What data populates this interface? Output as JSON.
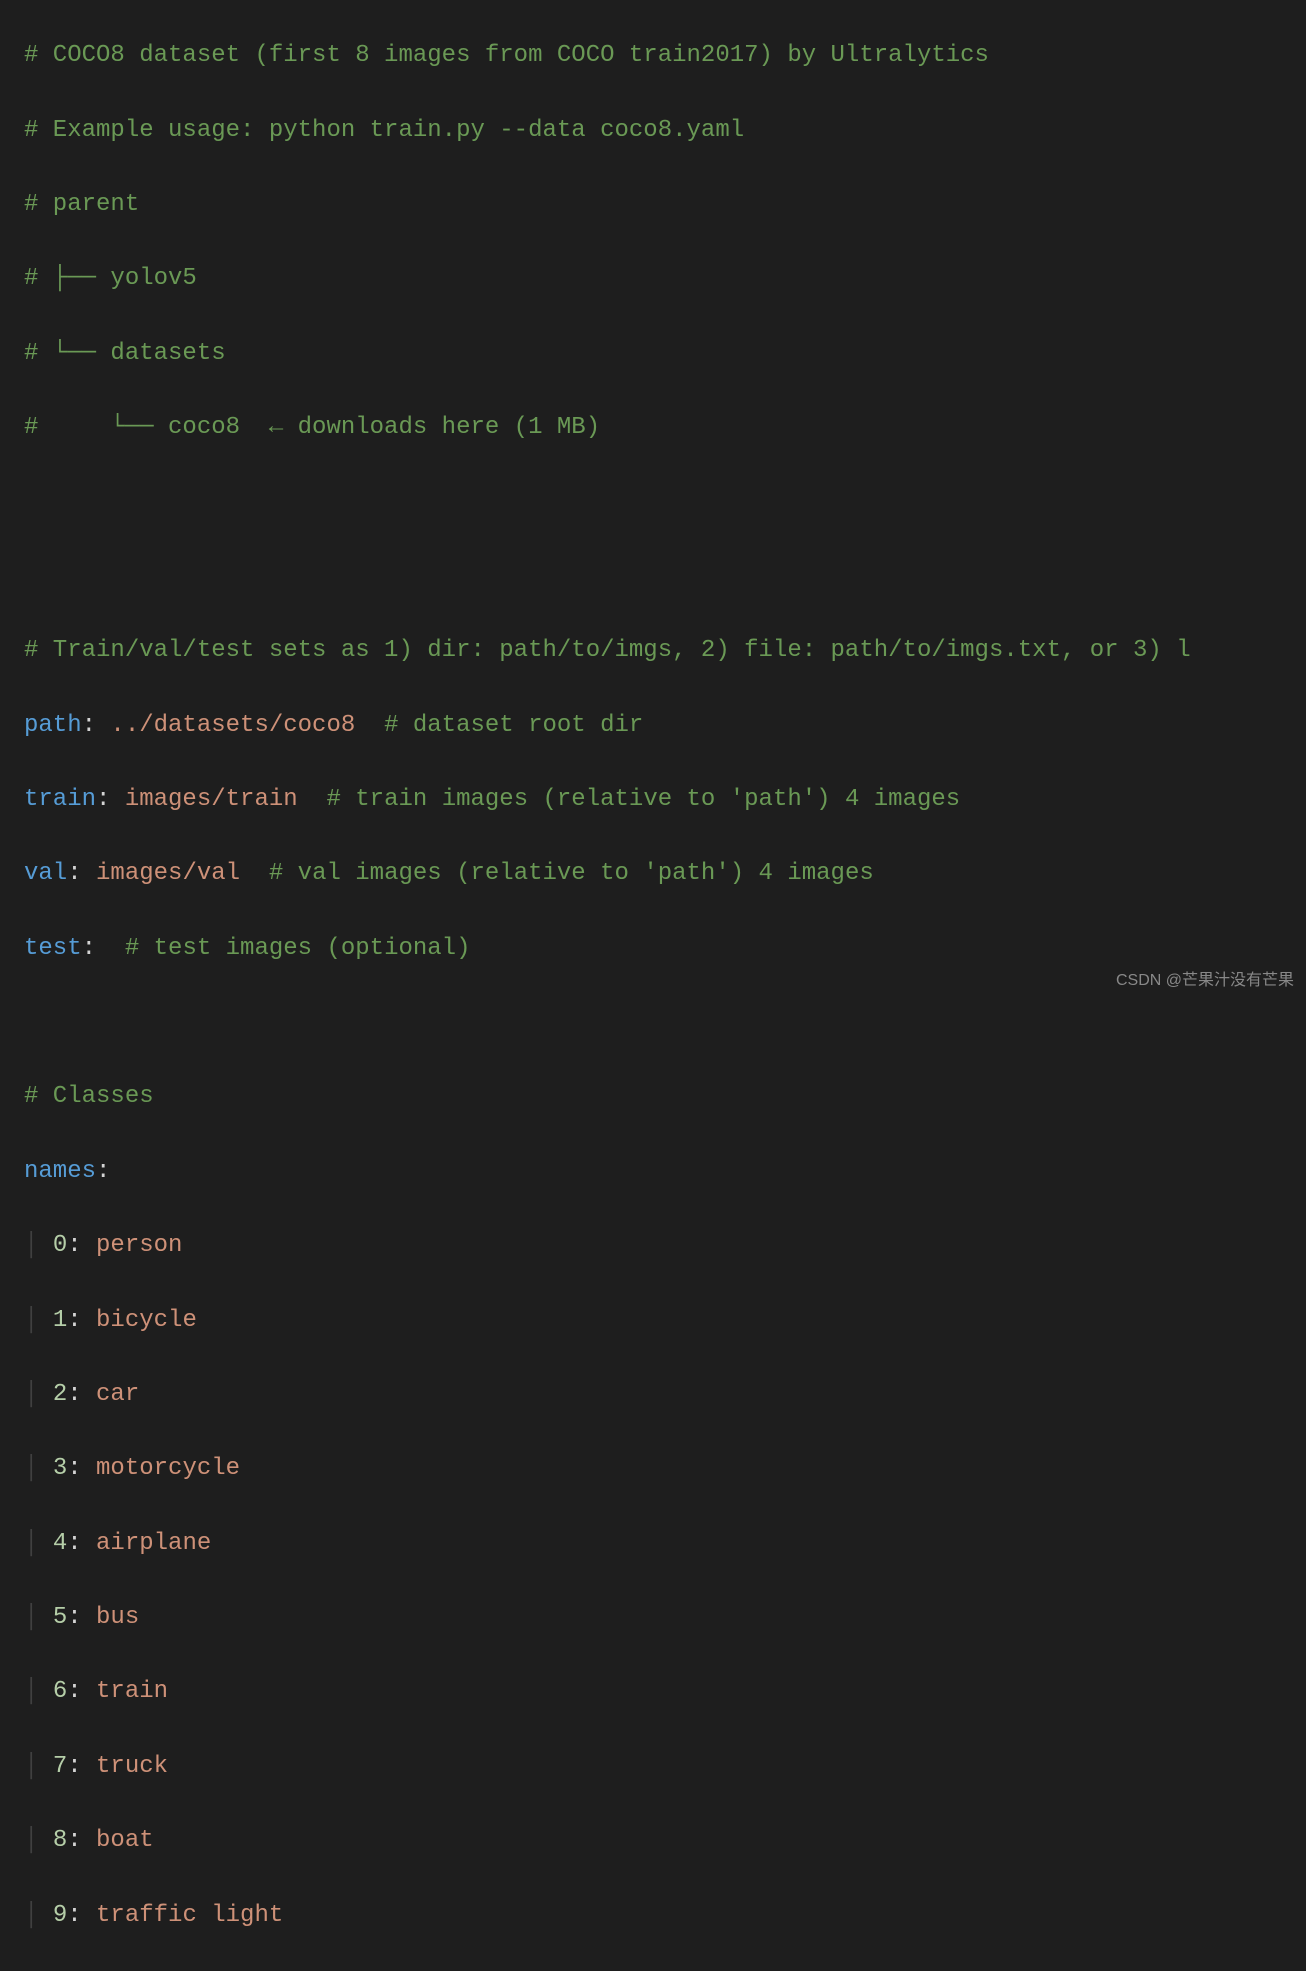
{
  "lines": {
    "l1": "# COCO8 dataset (first 8 images from COCO train2017) by Ultralytics",
    "l2": "# Example usage: python train.py --data coco8.yaml",
    "l3": "# parent",
    "l4": "# ├── yolov5",
    "l5": "# └── datasets",
    "l6": "#     └── coco8  ← downloads here (1 MB)",
    "l7": "",
    "l8": "",
    "l9": "# Train/val/test sets as 1) dir: path/to/imgs, 2) file: path/to/imgs.txt, or 3) l",
    "path_key": "path",
    "path_val": " ../datasets/coco8  ",
    "path_comment": "# dataset root dir",
    "train_key": "train",
    "train_val": " images/train  ",
    "train_comment": "# train images (relative to 'path') 4 images",
    "val_key": "val",
    "val_val": " images/val  ",
    "val_comment": "# val images (relative to 'path') 4 images",
    "test_key": "test",
    "test_val": "  ",
    "test_comment": "# test images (optional)",
    "classes_comment": "# Classes",
    "names_key": "names",
    "class_0_k": "0",
    "class_0_v": "person",
    "class_1_k": "1",
    "class_1_v": "bicycle",
    "class_2_k": "2",
    "class_2_v": "car",
    "class_3_k": "3",
    "class_3_v": "motorcycle",
    "class_4_k": "4",
    "class_4_v": "airplane",
    "class_5_k": "5",
    "class_5_v": "bus",
    "class_6_k": "6",
    "class_6_v": "train",
    "class_7_k": "7",
    "class_7_v": "truck",
    "class_8_k": "8",
    "class_8_v": "boat",
    "class_9_k": "9",
    "class_9_v": "traffic light"
  },
  "watermark": "CSDN @芒果汁没有芒果"
}
